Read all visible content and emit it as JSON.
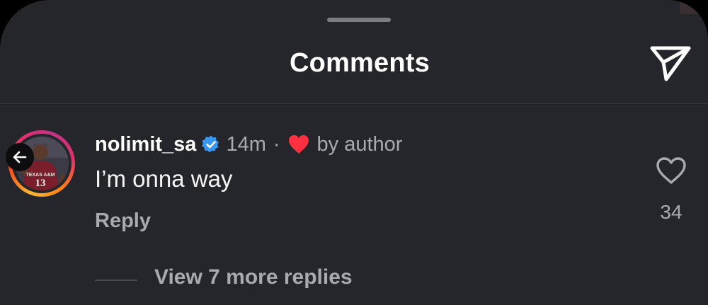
{
  "header": {
    "title": "Comments",
    "share_icon": "paper-plane-icon"
  },
  "comment": {
    "username": "nolimit_sa",
    "verified": true,
    "time": "14m",
    "separator": "·",
    "liked_by_author_label": "by author",
    "text": "I’m onna way",
    "reply_label": "Reply",
    "like_count": "34",
    "avatar_jersey_text": "13",
    "avatar_ring_colors": [
      "#f7b733",
      "#fc4a1a",
      "#e1306c",
      "#c13584"
    ]
  },
  "replies": {
    "label": "View 7 more replies"
  },
  "colors": {
    "background": "#25262b",
    "primary_text": "#ffffff",
    "secondary_text": "#a8aab0",
    "verified_blue": "#3897f0",
    "heart_red": "#ff3040"
  }
}
